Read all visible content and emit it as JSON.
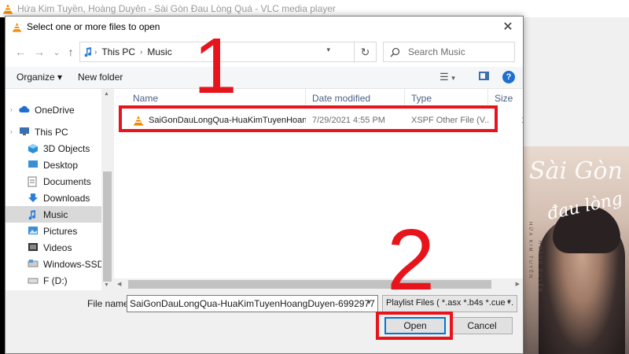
{
  "vlc": {
    "window_title": "Hứa Kim Tuyền, Hoàng Duyên - Sài Gòn Đau Lòng Quá - VLC media player",
    "album_art": {
      "script_text": "Sài Gòn",
      "script_text2": "đau lòng quá!",
      "artist_vertical_1": "HỨA KIM TUYỀN",
      "artist_vertical_2": "HOÀNG DUYÊN"
    }
  },
  "dialog": {
    "title": "Select one or more files to open",
    "close_glyph": "✕",
    "nav": {
      "back_glyph": "←",
      "forward_glyph": "→",
      "recent_glyph": "⌄",
      "up_glyph": "↑",
      "breadcrumbs": [
        "This PC",
        "Music"
      ],
      "refresh_glyph": "↻",
      "search_placeholder": "Search Music"
    },
    "toolbar": {
      "organize": "Organize ▾",
      "new_folder": "New folder",
      "help_glyph": "?"
    },
    "nav_pane": {
      "items": [
        {
          "label": "OneDrive",
          "icon": "cloud-icon",
          "color": "#1e6fd0"
        },
        {
          "label": "This PC",
          "icon": "computer-icon",
          "color": "#3a6fb0"
        },
        {
          "label": "3D Objects",
          "icon": "cube-icon",
          "color": "#2a8fd8"
        },
        {
          "label": "Desktop",
          "icon": "desktop-icon",
          "color": "#3a8fd8"
        },
        {
          "label": "Documents",
          "icon": "document-icon",
          "color": "#7a7a7a"
        },
        {
          "label": "Downloads",
          "icon": "download-icon",
          "color": "#2a7fd8"
        },
        {
          "label": "Music",
          "icon": "music-icon",
          "color": "#2a7fd8"
        },
        {
          "label": "Pictures",
          "icon": "pictures-icon",
          "color": "#3a8fd8"
        },
        {
          "label": "Videos",
          "icon": "video-icon",
          "color": "#333333"
        },
        {
          "label": "Windows-SSD (C",
          "icon": "drive-icon",
          "color": "#5a9ad8"
        },
        {
          "label": "F (D:)",
          "icon": "usb-drive-icon",
          "color": "#888888"
        }
      ]
    },
    "file_list": {
      "columns": [
        "Name",
        "Date modified",
        "Type",
        "Size"
      ],
      "rows": [
        {
          "name": "SaiGonDauLongQua-HuaKimTuyenHoan...",
          "date_modified": "7/29/2021 4:55 PM",
          "type": "XSPF Other File (V...",
          "size": "1"
        }
      ]
    },
    "bottom": {
      "filename_label": "File name:",
      "filename_value": "SaiGonDauLongQua-HuaKimTuyenHoangDuyen-6992977",
      "filter_value": "Playlist Files ( *.asx *.b4s *.cue *.",
      "open_label": "Open",
      "cancel_label": "Cancel"
    }
  },
  "annotations": {
    "step1": "1",
    "step2": "2",
    "color": "#e8141b"
  }
}
